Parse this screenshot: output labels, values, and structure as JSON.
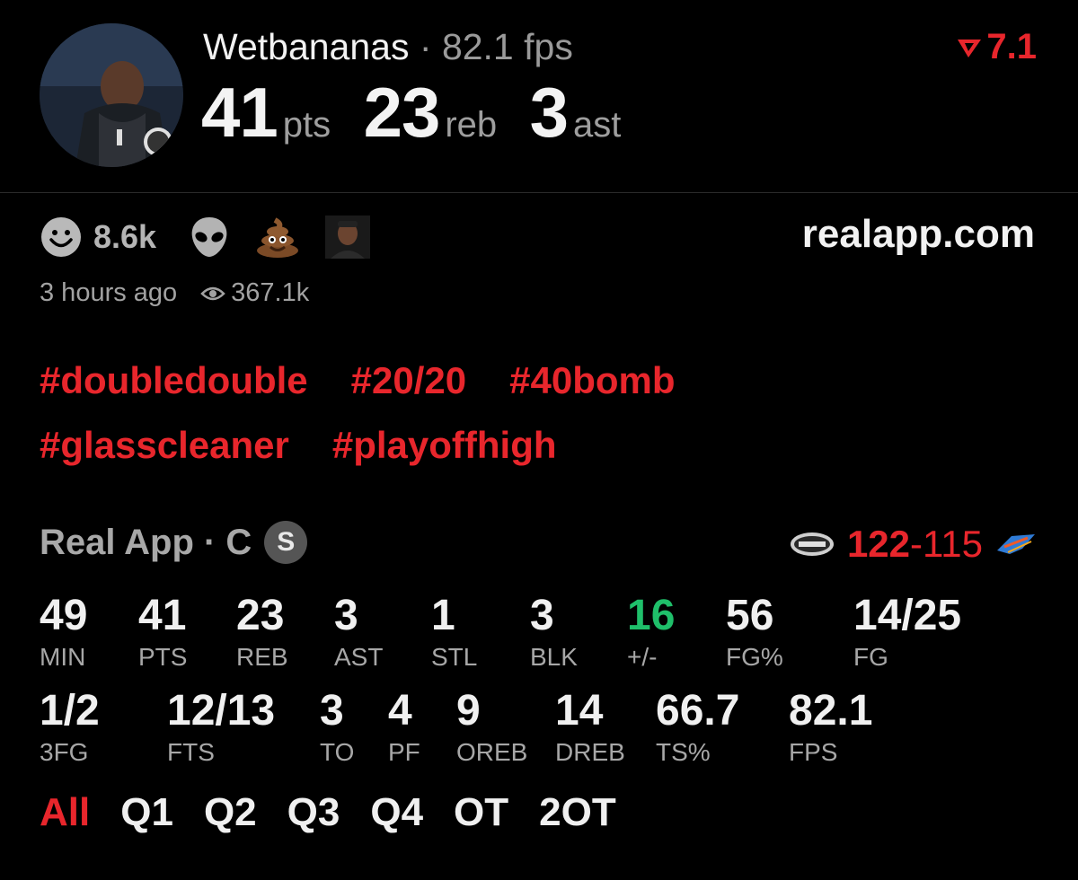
{
  "header": {
    "username": "Wetbananas",
    "separator": "·",
    "fps_text": "82.1 fps",
    "rating": "7.1",
    "points": "41",
    "points_unit": "pts",
    "rebounds": "23",
    "rebounds_unit": "reb",
    "assists": "3",
    "assists_unit": "ast"
  },
  "reactions": {
    "count": "8.6k",
    "icons": [
      "smile-face-icon",
      "alien-icon",
      "poop-emoji-icon",
      "user-avatar-icon"
    ]
  },
  "site": "realapp.com",
  "meta": {
    "time_ago": "3 hours ago",
    "views": "367.1k"
  },
  "hashtags": {
    "row1": [
      "#doubledouble",
      "#20/20",
      "#40bomb"
    ],
    "row2": [
      "#glasscleaner",
      "#playoffhigh"
    ]
  },
  "game": {
    "source": "Real App · C",
    "badge": "S",
    "home_score": "122",
    "dash": "-",
    "away_score": "115"
  },
  "stats": {
    "min": {
      "value": "49",
      "label": "MIN"
    },
    "pts": {
      "value": "41",
      "label": "PTS"
    },
    "reb": {
      "value": "23",
      "label": "REB"
    },
    "ast": {
      "value": "3",
      "label": "AST"
    },
    "stl": {
      "value": "1",
      "label": "STL"
    },
    "blk": {
      "value": "3",
      "label": "BLK"
    },
    "pm": {
      "value": "16",
      "label": "+/-"
    },
    "fgp": {
      "value": "56",
      "label": "FG%"
    },
    "fg": {
      "value": "14/25",
      "label": "FG"
    },
    "tfg": {
      "value": "1/2",
      "label": "3FG"
    },
    "fts": {
      "value": "12/13",
      "label": "FTS"
    },
    "to": {
      "value": "3",
      "label": "TO"
    },
    "pf": {
      "value": "4",
      "label": "PF"
    },
    "oreb": {
      "value": "9",
      "label": "OREB"
    },
    "dreb": {
      "value": "14",
      "label": "DREB"
    },
    "tsp": {
      "value": "66.7",
      "label": "TS%"
    },
    "fps": {
      "value": "82.1",
      "label": "FPS"
    }
  },
  "quarters": [
    "All",
    "Q1",
    "Q2",
    "Q3",
    "Q4",
    "OT",
    "2OT"
  ],
  "colors": {
    "accent": "#e8262c",
    "positive": "#1fbf6a",
    "muted": "#a7a7a7"
  }
}
